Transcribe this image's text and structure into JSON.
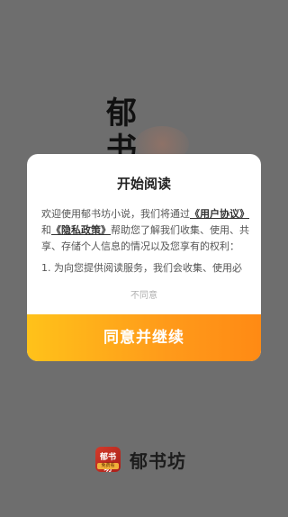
{
  "splash": {
    "title": "郁书坊"
  },
  "dialog": {
    "title": "开始阅读",
    "intro_prefix": "欢迎使用郁书坊小说，我们将通过",
    "user_agreement": "《用户协议》",
    "and": "和",
    "privacy_policy": "《隐私政策》",
    "intro_suffix": "帮助您了解我们收集、使用、共享、存储个人信息的情况以及您享有的权利：",
    "item1": "1. 为向您提供阅读服务，我们会收集、使用必",
    "disagree": "不同意",
    "agree": "同意并继续"
  },
  "brand": {
    "logo_text": "郁书坊",
    "logo_subtext": "免费看",
    "name": "郁书坊"
  },
  "colors": {
    "accent_start": "#ffc21a",
    "accent_end": "#ff8a14",
    "overlay": "#6e6e6e"
  }
}
